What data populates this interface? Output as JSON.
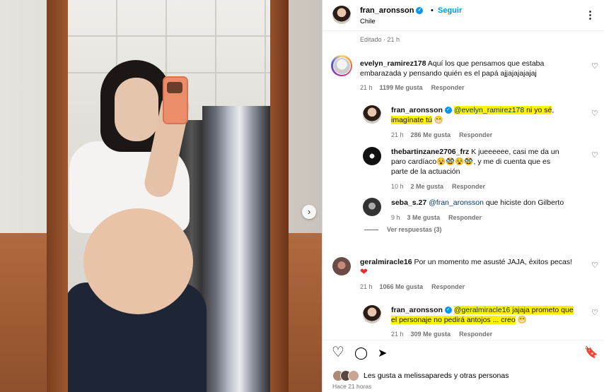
{
  "post": {
    "username": "fran_aronsson",
    "verified_mark": "✓",
    "dot": "•",
    "follow_label": "Seguir",
    "location": "Chile",
    "more_icon": "⋮",
    "edited": "Editado · 21 h",
    "carousel_next": "›"
  },
  "comments": [
    {
      "username": "evelyn_ramirez178",
      "text": "Aquí los que pensamos que estaba embarazada y pensando quién es el papá ajjajajajajaj",
      "time": "21 h",
      "likes": "1199 Me gusta",
      "reply": "Responder"
    },
    {
      "username": "fran_aronsson",
      "mention": "@evelyn_ramirez178",
      "text_hl": " ni yo sé",
      "text_after": ",",
      "text_line2": "imagínate tú",
      "emoji": "😁",
      "time": "21 h",
      "likes": "286 Me gusta",
      "reply": "Responder"
    },
    {
      "username": "thebartinzane2706_frz",
      "text": "K jueeeeee, casi me da un paro cardíaco😵🥸😵🥸, y me di cuenta que es parte de la actuación",
      "time": "10 h",
      "likes": "2 Me gusta",
      "reply": "Responder"
    },
    {
      "username": "seba_s.27",
      "mention": "@fran_aronsson",
      "text": " que hiciste don Gilberto",
      "time": "9 h",
      "likes": "3 Me gusta",
      "reply": "Responder"
    },
    {
      "username": "geralmiracle16",
      "text": "Por un momento me asusté JAJA, éxitos pecas!",
      "emoji": "❤",
      "time": "21 h",
      "likes": "1066 Me gusta",
      "reply": "Responder"
    },
    {
      "username": "fran_aronsson",
      "mention": "@geralmiracle16",
      "text_hl": " jajaja prometo que",
      "text_line2": "el personaje no pedirá antojos ... creo",
      "emoji": "😁",
      "time": "21 h",
      "likes": "309 Me gusta",
      "reply": "Responder"
    }
  ],
  "view_replies": "Ver respuestas (3)",
  "actions": {
    "like_icon": "♡",
    "comment_icon": "◯",
    "share_icon": "➤",
    "save_icon": "🔖"
  },
  "likes_text": "Les gusta a melissapareds y otras personas",
  "time_ago": "Hace 21 horas",
  "heart_icon": "♡"
}
